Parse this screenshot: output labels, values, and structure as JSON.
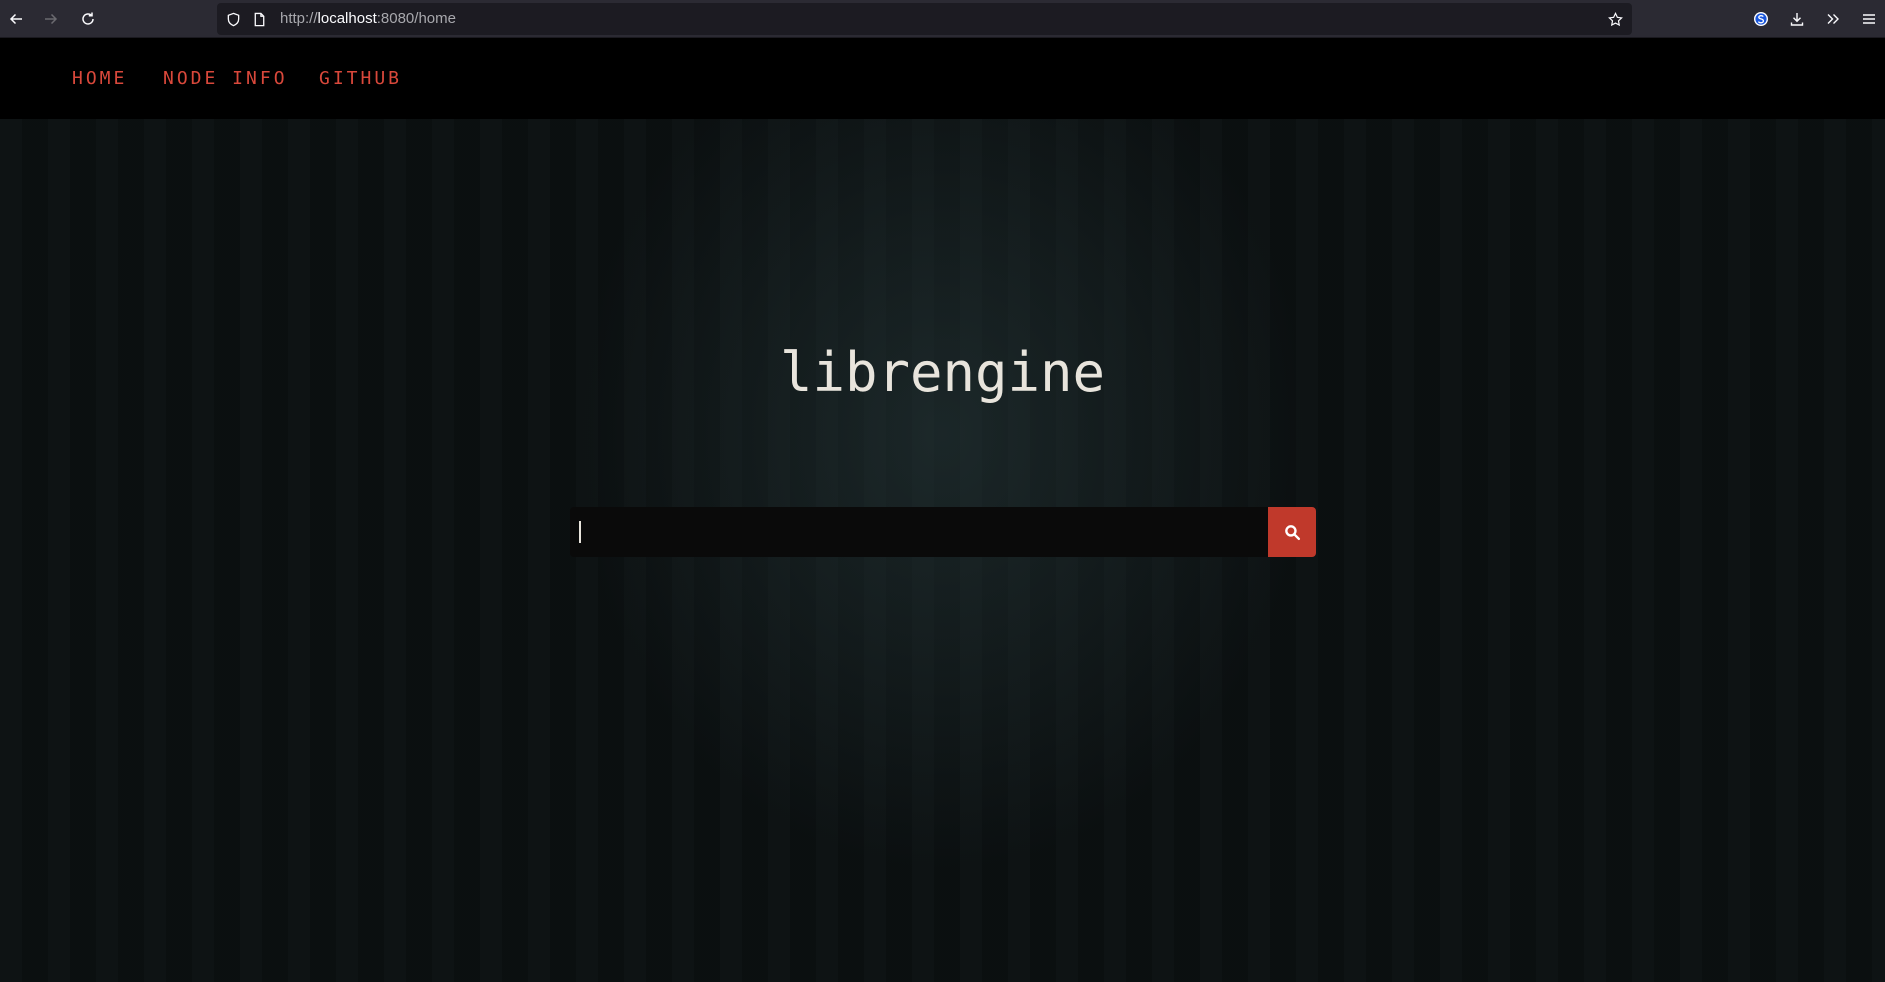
{
  "browser": {
    "url_scheme": "http://",
    "url_host": "localhost",
    "url_rest": ":8080/home",
    "icons": [
      "back-icon",
      "forward-icon",
      "reload-icon",
      "shield-icon",
      "page-icon",
      "star-icon",
      "extension-icon",
      "download-icon",
      "overflow-icon",
      "menu-icon"
    ]
  },
  "nav": {
    "items": [
      {
        "label": "HOME"
      },
      {
        "label": "NODE INFO"
      },
      {
        "label": "GITHUB"
      }
    ]
  },
  "main": {
    "title": "librengine",
    "search": {
      "value": "",
      "placeholder": ""
    },
    "search_button_icon": "search-icon"
  },
  "colors": {
    "accent": "#c0392b",
    "nav_link": "#d9483b",
    "title_text": "#e8e4dc",
    "page_bg": "#0b1011",
    "nav_bg": "#000000"
  }
}
